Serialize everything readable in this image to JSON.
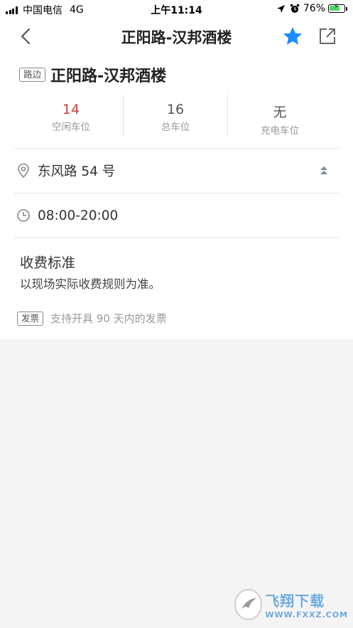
{
  "status_bar": {
    "carrier": "中国电信",
    "network": "4G",
    "time": "上午11:14",
    "battery": "76%",
    "battery_level": 0.76
  },
  "nav": {
    "title": "正阳路-汉邦酒楼",
    "back_icon": "chevron-left-icon",
    "favorite_icon": "star-icon",
    "share_icon": "share-icon",
    "accent_color": "#1a8cff"
  },
  "lot": {
    "type_tag": "路边",
    "name": "正阳路-汉邦酒楼"
  },
  "stats": [
    {
      "value": "14",
      "label": "空闲车位",
      "color": "#d33a3a"
    },
    {
      "value": "16",
      "label": "总车位"
    },
    {
      "value": "无",
      "label": "充电车位"
    }
  ],
  "address": "东风路 54 号",
  "hours": "08:00-20:00",
  "fee": {
    "title": "收费标准",
    "description": "以现场实际收费规则为准。"
  },
  "invoice": {
    "tag": "发票",
    "text": "支持开具 90 天内的发票"
  },
  "watermark": {
    "name": "飞翔下载",
    "url": "WWW.FXXZ.COM"
  }
}
